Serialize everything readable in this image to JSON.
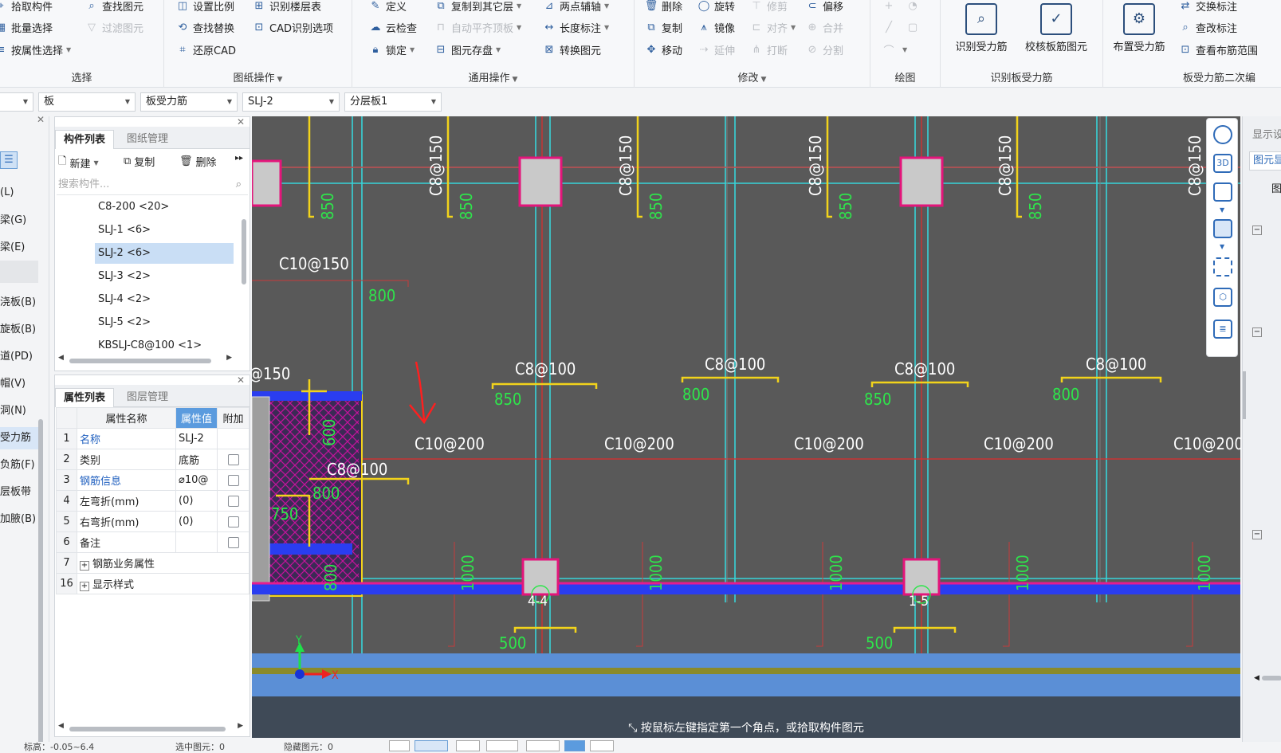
{
  "ribbon": {
    "groups": [
      {
        "title": "选择",
        "items": [
          {
            "label": "拾取构件",
            "icon": "pick-icon",
            "enabled": true
          },
          {
            "label": "批量选择",
            "icon": "batch-select-icon",
            "enabled": true
          },
          {
            "label": "按属性选择",
            "icon": "attribute-select-icon",
            "enabled": true
          },
          {
            "label": "查找图元",
            "icon": "find-icon",
            "enabled": true
          },
          {
            "label": "过滤图元",
            "icon": "filter-icon",
            "enabled": false
          }
        ]
      },
      {
        "title": "图纸操作",
        "items": [
          {
            "label": "设置比例",
            "icon": "scale-icon",
            "enabled": true
          },
          {
            "label": "查找替换",
            "icon": "replace-icon",
            "enabled": true
          },
          {
            "label": "还原CAD",
            "icon": "restore-cad-icon",
            "enabled": true
          },
          {
            "label": "识别楼层表",
            "icon": "floor-table-icon",
            "enabled": true
          },
          {
            "label": "CAD识别选项",
            "icon": "cad-options-icon",
            "enabled": true
          }
        ]
      },
      {
        "title": "通用操作",
        "items": [
          {
            "label": "定义",
            "icon": "define-icon",
            "enabled": true
          },
          {
            "label": "云检查",
            "icon": "cloud-check-icon",
            "enabled": true
          },
          {
            "label": "锁定",
            "icon": "lock-icon",
            "enabled": true
          },
          {
            "label": "复制到其它层",
            "icon": "copy-layer-icon",
            "enabled": true
          },
          {
            "label": "自动平齐顶板",
            "icon": "align-top-icon",
            "enabled": false
          },
          {
            "label": "图元存盘",
            "icon": "save-element-icon",
            "enabled": true
          },
          {
            "label": "两点辅轴",
            "icon": "two-point-axis-icon",
            "enabled": true
          },
          {
            "label": "长度标注",
            "icon": "length-dimension-icon",
            "enabled": true
          },
          {
            "label": "转换图元",
            "icon": "convert-icon",
            "enabled": true
          }
        ]
      },
      {
        "title": "修改",
        "items": [
          {
            "label": "删除",
            "icon": "delete-icon",
            "enabled": true
          },
          {
            "label": "复制",
            "icon": "copy-icon",
            "enabled": true
          },
          {
            "label": "移动",
            "icon": "move-icon",
            "enabled": true
          },
          {
            "label": "旋转",
            "icon": "rotate-icon",
            "enabled": true
          },
          {
            "label": "镜像",
            "icon": "mirror-icon",
            "enabled": true
          },
          {
            "label": "延伸",
            "icon": "extend-icon",
            "enabled": false
          },
          {
            "label": "修剪",
            "icon": "trim-icon",
            "enabled": false
          },
          {
            "label": "对齐",
            "icon": "align-icon",
            "enabled": false
          },
          {
            "label": "打断",
            "icon": "break-icon",
            "enabled": false
          },
          {
            "label": "偏移",
            "icon": "offset-icon",
            "enabled": true
          },
          {
            "label": "合并",
            "icon": "merge-icon",
            "enabled": false
          },
          {
            "label": "分割",
            "icon": "split-icon",
            "enabled": false
          }
        ]
      },
      {
        "title": "绘图",
        "items": []
      },
      {
        "title": "识别板受力筋",
        "items": [
          {
            "label": "识别受力筋",
            "icon": "identify-rebar-icon",
            "enabled": true
          },
          {
            "label": "校核板筋图元",
            "icon": "check-rebar-icon",
            "enabled": true
          }
        ]
      },
      {
        "title": "板受力筋二次编",
        "items": [
          {
            "label": "布置受力筋",
            "icon": "place-rebar-icon",
            "enabled": true
          },
          {
            "label": "交换标注",
            "icon": "swap-label-icon",
            "enabled": true
          },
          {
            "label": "查改标注",
            "icon": "edit-label-icon",
            "enabled": true
          },
          {
            "label": "查看布筋范围",
            "icon": "view-range-icon",
            "enabled": true
          }
        ]
      }
    ]
  },
  "filters": [
    "",
    "板",
    "板受力筋",
    "SLJ-2",
    "分层板1"
  ],
  "left_strip": [
    "(L)",
    "梁(G)",
    "梁(E)",
    "浇板(B)",
    "旋板(B)",
    "道(PD)",
    "帽(V)",
    "洞(N)",
    "受力筋",
    "负筋(F)",
    "层板带",
    "加腋(B)"
  ],
  "component_panel": {
    "tabs": [
      "构件列表",
      "图纸管理"
    ],
    "tools": [
      "新建",
      "复制",
      "删除"
    ],
    "search_placeholder": "搜索构件...",
    "items": [
      "C8-200 <20>",
      "SLJ-1 <6>",
      "SLJ-2 <6>",
      "SLJ-3 <2>",
      "SLJ-4 <2>",
      "SLJ-5 <2>",
      "KBSLJ-C8@100 <1>"
    ],
    "selected_index": 2
  },
  "property_panel": {
    "tabs": [
      "属性列表",
      "图层管理"
    ],
    "headers": [
      "属性名称",
      "属性值",
      "附加"
    ],
    "rows": [
      {
        "no": "1",
        "name": "名称",
        "value": "SLJ-2",
        "link": true,
        "check": false
      },
      {
        "no": "2",
        "name": "类别",
        "value": "底筋",
        "link": false,
        "check": true
      },
      {
        "no": "3",
        "name": "钢筋信息",
        "value": "⌀10@",
        "link": true,
        "check": true
      },
      {
        "no": "4",
        "name": "左弯折(mm)",
        "value": "(0)",
        "link": false,
        "check": true
      },
      {
        "no": "5",
        "name": "右弯折(mm)",
        "value": "(0)",
        "link": false,
        "check": true
      },
      {
        "no": "6",
        "name": "备注",
        "value": "",
        "link": false,
        "check": true
      },
      {
        "no": "7",
        "name": "钢筋业务属性",
        "value": "",
        "link": false,
        "check": false,
        "expand": true
      },
      {
        "no": "16",
        "name": "显示样式",
        "value": "",
        "link": false,
        "check": false,
        "expand": true
      }
    ]
  },
  "canvas": {
    "labels_white": [
      "C8@150",
      "C8@150",
      "C8@150",
      "C8@150",
      "C8@150",
      "C10@150",
      "@150",
      "C8@100",
      "C8@100",
      "C8@100",
      "C8@100",
      "C10@200",
      "C10@200",
      "C10@200",
      "C10@200",
      "C10@200",
      "C8@100",
      "4-4",
      "1-5"
    ],
    "labels_green": [
      "850",
      "850",
      "850",
      "850",
      "850",
      "800",
      "850",
      "800",
      "850",
      "800",
      "600",
      "800",
      "750",
      "800",
      "1000",
      "1000",
      "1000",
      "1000",
      "1000",
      "500",
      "500"
    ],
    "axis_x": "X",
    "axis_y": "Y",
    "status_hint": "按鼠标左键指定第一个角点，或拾取构件图元",
    "colors": {
      "background": "#595959",
      "grid": "#37d4d9",
      "rebar": "#f2d31b",
      "column": "#e3157a",
      "text": "#ffffff",
      "dimension": "#2ee64b"
    }
  },
  "right_panel": {
    "title": "显示设置",
    "tab": "图元显示",
    "sub": "图"
  },
  "bottom_status": {
    "elevation": "标高：-0.05~6.4",
    "selected": "选中图元：0",
    "hidden": "隐藏图元：0"
  }
}
